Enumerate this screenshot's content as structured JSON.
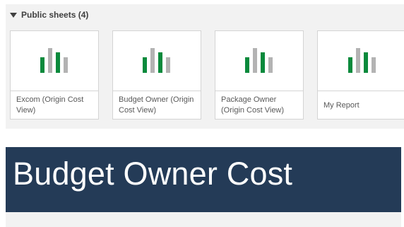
{
  "section": {
    "title": "Public sheets (4)"
  },
  "sheets": [
    {
      "title": "Excom (Origin Cost View)"
    },
    {
      "title": "Budget Owner (Origin Cost View)"
    },
    {
      "title": "Package Owner (Origin Cost View)"
    },
    {
      "title": "My Report"
    }
  ],
  "banner": {
    "title": "Budget Owner Cost"
  },
  "colors": {
    "panel_bg": "#f2f2f2",
    "bar_green": "#0a8a3c",
    "bar_gray": "#b3b3b3",
    "banner_bg": "#243b57",
    "banner_text": "#ffffff"
  },
  "icons": {
    "section_toggle": "caret-down-icon",
    "sheet_thumbnail": "bar-chart-icon"
  }
}
